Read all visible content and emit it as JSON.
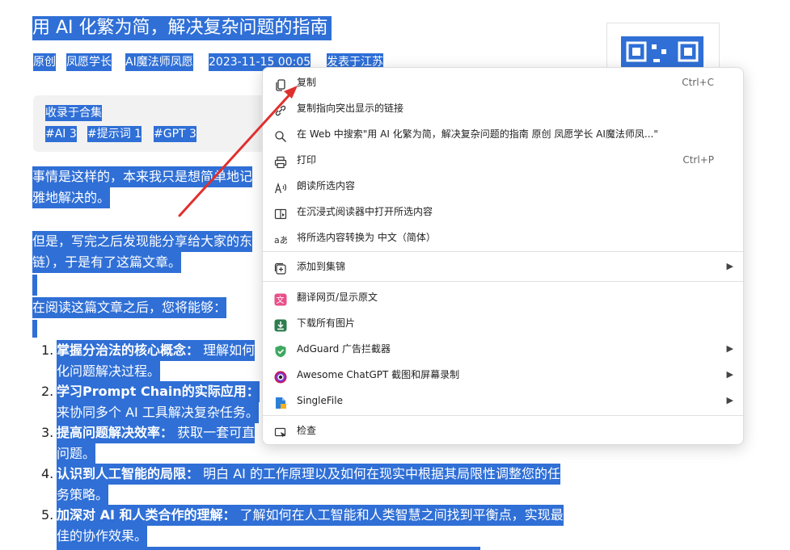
{
  "article": {
    "title": "用 AI 化繁为简，解决复杂问题的指南",
    "meta": [
      "原创",
      "凤愿学长",
      "AI魔法师凤愿",
      "2023-11-15 00:05",
      "发表于江苏"
    ],
    "collection_title": "收录于合集",
    "tags": [
      "#AI 3",
      "#提示词 1",
      "#GPT 3"
    ],
    "p1_line1": "事情是这样的，本来我只是想简单地记",
    "p1_line2": "雅地解决的。",
    "p2_line1": "但是，写完之后发现能分享给大家的东",
    "p2_line2": "链），于是有了这篇文章。",
    "intro": "在阅读这篇文章之后，您将能够：",
    "list": [
      {
        "num": "1.",
        "bold": "掌握分治法的核心概念：",
        "text1": "理解如何",
        "text2": "化问题解决过程。"
      },
      {
        "num": "2.",
        "bold": "学习Prompt Chain的实际应用：",
        "text1": "",
        "text2": "来协同多个 AI 工具解决复杂任务。"
      },
      {
        "num": "3.",
        "bold": "提高问题解决效率：",
        "text1": "获取一套可直",
        "text2": "问题。"
      },
      {
        "num": "4.",
        "bold": "认识到人工智能的局限：",
        "text1": "明白 AI 的工作原理以及如何在现实中根据其局限性调整您的任",
        "text2": "务策略。"
      },
      {
        "num": "5.",
        "bold": "加深对 AI 和人类合作的理解：",
        "text1": "了解如何在人工智能和人类智慧之间找到平衡点，实现最",
        "text2": "佳的协作效果。"
      }
    ]
  },
  "context_menu": {
    "items": [
      {
        "label": "复制",
        "shortcut": "Ctrl+C",
        "icon": "copy-icon"
      },
      {
        "label": "复制指向突出显示的链接",
        "icon": "link-icon"
      },
      {
        "label": "在 Web 中搜索\"用 AI 化繁为简，解决复杂问题的指南 原创 凤愿学长 AI魔法师凤...\"",
        "icon": "search-icon"
      },
      {
        "label": "打印",
        "shortcut": "Ctrl+P",
        "icon": "print-icon"
      },
      {
        "label": "朗读所选内容",
        "icon": "read-aloud-icon"
      },
      {
        "label": "在沉浸式阅读器中打开所选内容",
        "icon": "immersive-reader-icon"
      },
      {
        "label": "将所选内容转换为 中文（简体）",
        "icon": "translate-icon"
      },
      {
        "label": "添加到集锦",
        "icon": "collections-icon"
      },
      {
        "label": "翻译网页/显示原文",
        "icon": "translate-ext-icon"
      },
      {
        "label": "下载所有图片",
        "icon": "download-images-icon"
      },
      {
        "label": "AdGuard 广告拦截器",
        "icon": "adguard-icon"
      },
      {
        "label": "Awesome ChatGPT 截图和屏幕录制",
        "icon": "awesome-screenshot-icon"
      },
      {
        "label": "SingleFile",
        "icon": "singlefile-icon"
      },
      {
        "label": "检查",
        "icon": "inspect-icon"
      }
    ]
  },
  "colors": {
    "selection": "#2f6fd6",
    "arrow": "#e0302e",
    "adguard": "#3fa860",
    "translate_ext": "#e8508a",
    "download": "#2e7d4f",
    "singlefile": "#2b7fd8"
  }
}
